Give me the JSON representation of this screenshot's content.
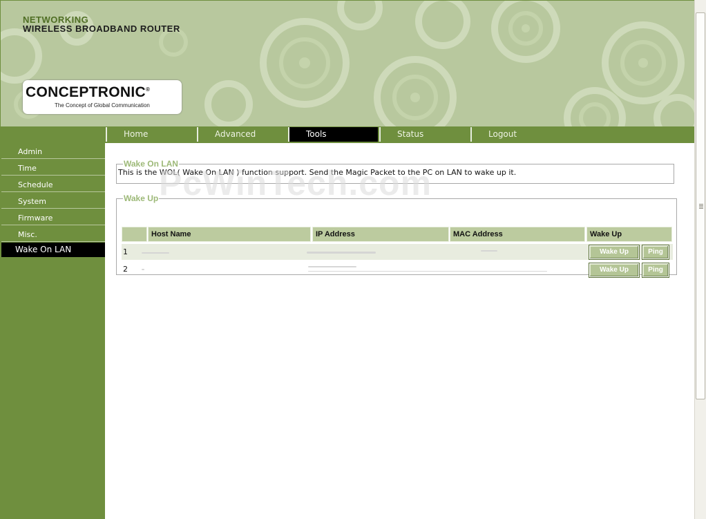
{
  "header": {
    "brand_line1": "NETWORKING",
    "brand_line2": "WIRELESS BROADBAND ROUTER",
    "logo_name": "CONCEPTRONIC",
    "logo_reg": "®",
    "logo_tagline": "The Concept of Global Communication"
  },
  "nav": {
    "tabs": [
      {
        "label": "Home"
      },
      {
        "label": "Advanced"
      },
      {
        "label": "Tools",
        "active": true
      },
      {
        "label": "Status"
      },
      {
        "label": "Logout"
      }
    ]
  },
  "sidebar": {
    "items": [
      {
        "label": "Admin"
      },
      {
        "label": "Time"
      },
      {
        "label": "Schedule"
      },
      {
        "label": "System"
      },
      {
        "label": "Firmware"
      },
      {
        "label": "Misc."
      },
      {
        "label": "Wake On LAN",
        "active": true
      }
    ]
  },
  "wol": {
    "legend": "Wake On LAN",
    "description": "This is the WOL( Wake On LAN ) function support. Send the Magic Packet to the PC on LAN to wake up it."
  },
  "wakeup": {
    "legend": "Wake Up",
    "columns": [
      "",
      "Host Name",
      "IP Address",
      "MAC Address",
      "Wake Up"
    ],
    "rows": [
      {
        "index": "1",
        "wake_label": "Wake Up",
        "ping_label": "Ping"
      },
      {
        "index": "2",
        "wake_label": "Wake Up",
        "ping_label": "Ping"
      }
    ]
  },
  "watermark": "PcWinTech.com",
  "colors": {
    "accent_green": "#6f8f3e",
    "header_green": "#b8c89e",
    "legend_green": "#9db978",
    "table_header": "#bccb9f"
  }
}
